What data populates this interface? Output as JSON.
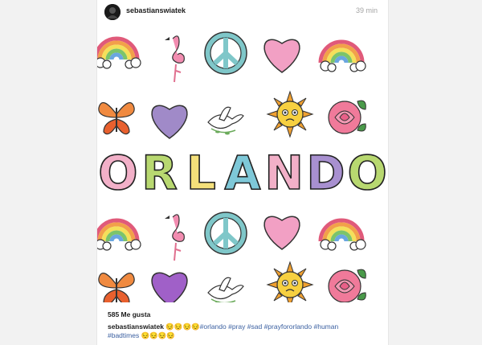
{
  "post": {
    "username": "sebastianswiatek",
    "time": "39 min",
    "likes": "585 Me gusta",
    "caption": {
      "username": "sebastianswiatek",
      "emoji_1": "😔😔😔😔",
      "hashtags": [
        "#orlando",
        "#pray",
        "#sad",
        "#prayfororlando",
        "#human",
        "#badtimes"
      ],
      "emoji_2": "😔😔😔😔"
    }
  },
  "image": {
    "word": "ORLANDO"
  }
}
